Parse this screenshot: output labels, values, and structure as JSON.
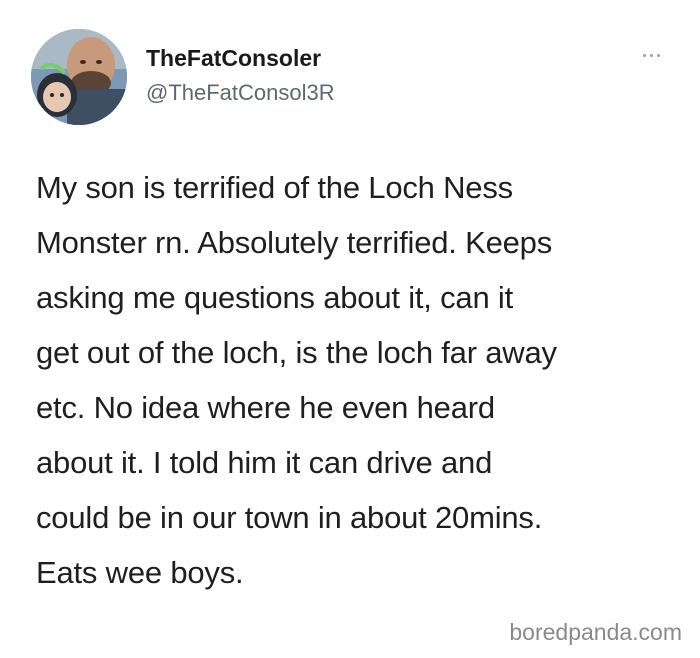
{
  "tweet": {
    "display_name": "TheFatConsoler",
    "handle": "@TheFatConsol3R",
    "more_icon": "more-horizontal-icon",
    "text": "My son is terrified of the Loch Ness\nMonster rn. Absolutely terrified. Keeps\nasking me questions about it, can it\nget out of the loch, is the loch far away\netc. No idea where he even heard\nabout it. I told him it can drive and\ncould be in our town in about 20mins.\nEats wee boys."
  },
  "watermark": "boredpanda.com",
  "colors": {
    "background": "#ffffff",
    "text": "#1f1f1f",
    "handle": "#5f6870",
    "watermark": "#8a8a8a"
  }
}
